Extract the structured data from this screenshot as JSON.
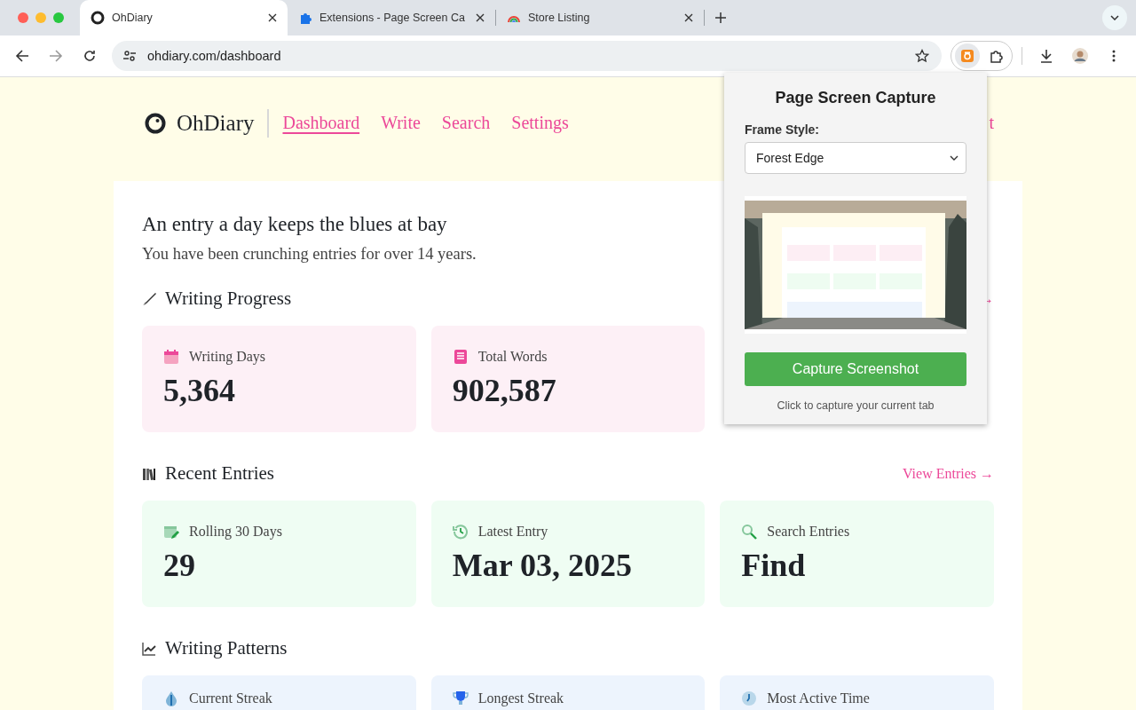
{
  "browser": {
    "tabs": [
      {
        "title": "OhDiary",
        "selected": true
      },
      {
        "title": "Extensions - Page Screen Ca",
        "selected": false
      },
      {
        "title": "Store Listing",
        "selected": false
      }
    ],
    "address": "ohdiary.com/dashboard"
  },
  "site": {
    "brand": "OhDiary",
    "nav": [
      {
        "label": "Dashboard",
        "selected": true
      },
      {
        "label": "Write",
        "selected": false
      },
      {
        "label": "Search",
        "selected": false
      },
      {
        "label": "Settings",
        "selected": false
      }
    ],
    "header_link": "t"
  },
  "intro": {
    "title": "An entry a day keeps the blues at bay",
    "subtitle": "You have been crunching entries for over 14 years."
  },
  "sections": [
    {
      "title": "Writing Progress",
      "link": "→",
      "color": "#fdf0f6",
      "cards": [
        {
          "label": "Writing Days",
          "value": "5,364"
        },
        {
          "label": "Total Words",
          "value": "902,587"
        }
      ]
    },
    {
      "title": "Recent Entries",
      "link": "View Entries →",
      "color": "#effdf3",
      "cards": [
        {
          "label": "Rolling 30 Days",
          "value": "29"
        },
        {
          "label": "Latest Entry",
          "value": "Mar 03, 2025"
        },
        {
          "label": "Search Entries",
          "value": "Find"
        }
      ]
    },
    {
      "title": "Writing Patterns",
      "color": "#edf4fd",
      "cards": [
        {
          "label": "Current Streak"
        },
        {
          "label": "Longest Streak"
        },
        {
          "label": "Most Active Time"
        }
      ]
    }
  ],
  "popup": {
    "title": "Page Screen Capture",
    "field_label": "Frame Style:",
    "select_value": "Forest Edge",
    "button": "Capture Screenshot",
    "hint": "Click to capture your current tab"
  }
}
